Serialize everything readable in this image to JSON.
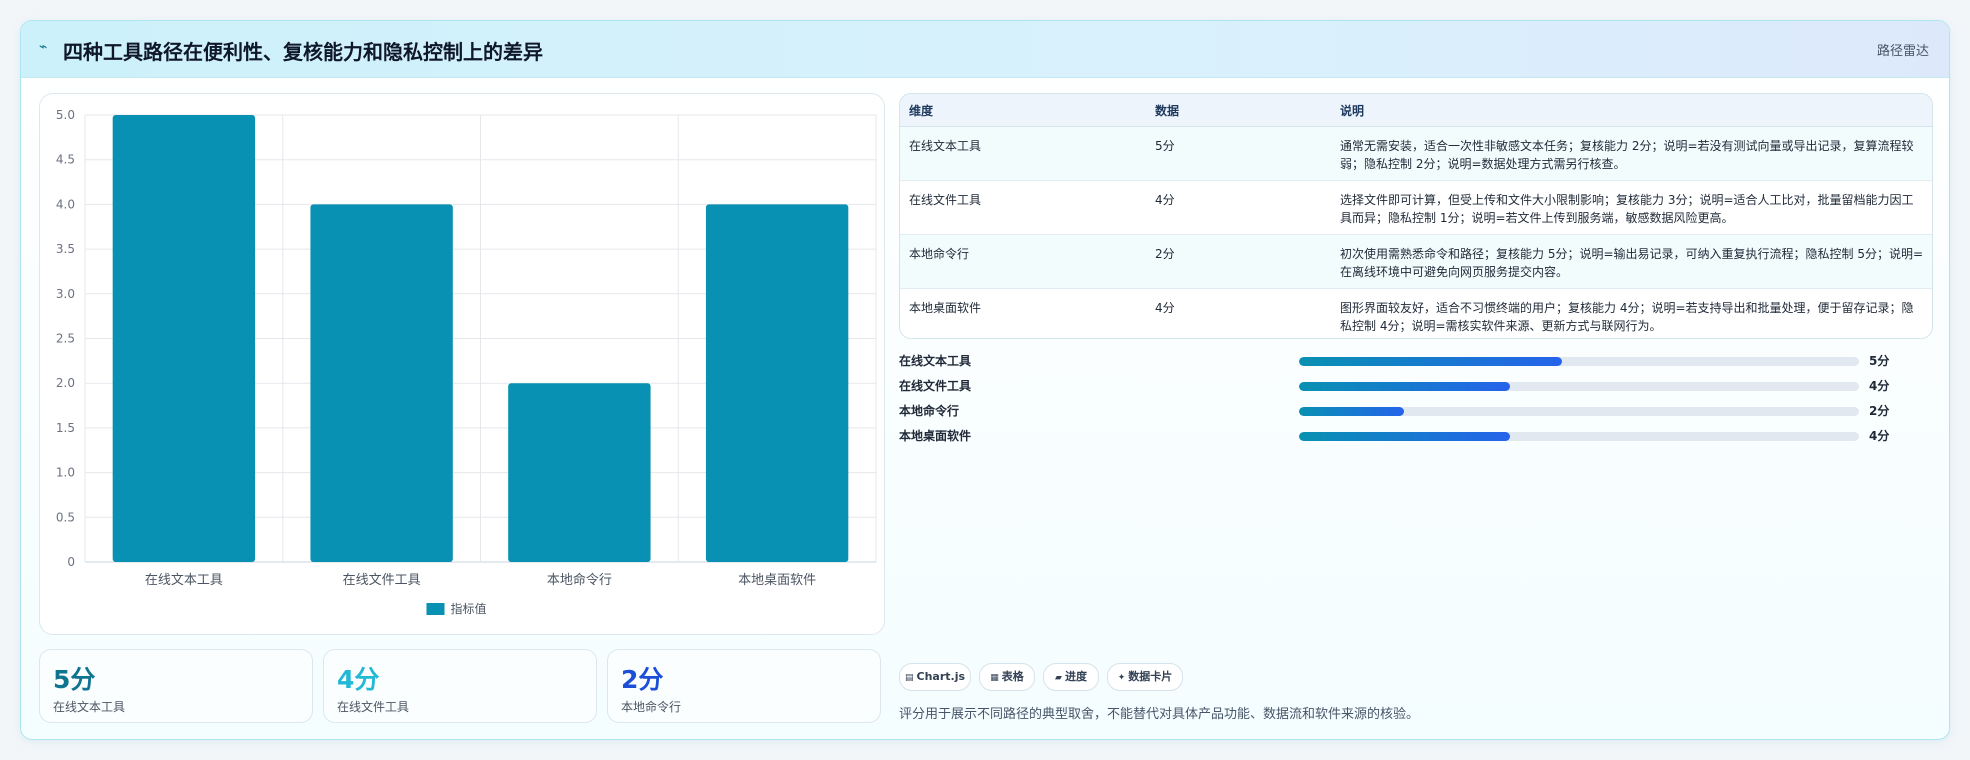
{
  "header": {
    "icon": "trend-icon",
    "title": "四种工具路径在便利性、复核能力和隐私控制上的差异",
    "badge": "路径雷达"
  },
  "chart_data": {
    "type": "bar",
    "categories": [
      "在线文本工具",
      "在线文件工具",
      "本地命令行",
      "本地桌面软件"
    ],
    "series": [
      {
        "name": "指标值",
        "values": [
          5,
          4,
          2,
          4
        ]
      }
    ],
    "ylim": [
      0,
      5
    ],
    "yticks": [
      "5.0",
      "4.5",
      "4.0",
      "3.5",
      "3.0",
      "2.5",
      "2.0",
      "1.5",
      "1.0",
      "0.5",
      "0"
    ],
    "grid": true,
    "legend_position": "bottom",
    "bar_color": "#0891b2"
  },
  "table": {
    "headers": [
      "维度",
      "数据",
      "说明"
    ],
    "rows": [
      [
        "在线文本工具",
        "5分",
        "通常无需安装，适合一次性非敏感文本任务；复核能力 2分；说明=若没有测试向量或导出记录，复算流程较弱；隐私控制 2分；说明=数据处理方式需另行核查。"
      ],
      [
        "在线文件工具",
        "4分",
        "选择文件即可计算，但受上传和文件大小限制影响；复核能力 3分；说明=适合人工比对，批量留档能力因工具而异；隐私控制 1分；说明=若文件上传到服务端，敏感数据风险更高。"
      ],
      [
        "本地命令行",
        "2分",
        "初次使用需熟悉命令和路径；复核能力 5分；说明=输出易记录，可纳入重复执行流程；隐私控制 5分；说明=在离线环境中可避免向网页服务提交内容。"
      ],
      [
        "本地桌面软件",
        "4分",
        "图形界面较友好，适合不习惯终端的用户；复核能力 4分；说明=若支持导出和批量处理，便于留存记录；隐私控制 4分；说明=需核实软件来源、更新方式与联网行为。"
      ]
    ]
  },
  "progress": [
    {
      "label": "在线文本工具",
      "value": 5,
      "max": 5,
      "text": "5分",
      "fraction": 0.47
    },
    {
      "label": "在线文件工具",
      "value": 4,
      "max": 5,
      "text": "4分",
      "fraction": 0.376
    },
    {
      "label": "本地命令行",
      "value": 2,
      "max": 5,
      "text": "2分",
      "fraction": 0.188
    },
    {
      "label": "本地桌面软件",
      "value": 4,
      "max": 5,
      "text": "4分",
      "fraction": 0.376
    }
  ],
  "kpis": [
    {
      "value": "5分",
      "label": "在线文本工具",
      "color": "#0e7490"
    },
    {
      "value": "4分",
      "label": "在线文件工具",
      "color": "#22b8d6"
    },
    {
      "value": "2分",
      "label": "本地命令行",
      "color": "#1d4ed8"
    }
  ],
  "tags": [
    {
      "icon": "chart-icon",
      "glyph": "▤",
      "label": "Chart.js"
    },
    {
      "icon": "table-icon",
      "glyph": "▦",
      "label": "表格"
    },
    {
      "icon": "progress-icon",
      "glyph": "▰",
      "label": "进度"
    },
    {
      "icon": "card-icon",
      "glyph": "✦",
      "label": "数据卡片"
    }
  ],
  "note": "评分用于展示不同路径的典型取舍，不能替代对具体产品功能、数据流和软件来源的核验。"
}
